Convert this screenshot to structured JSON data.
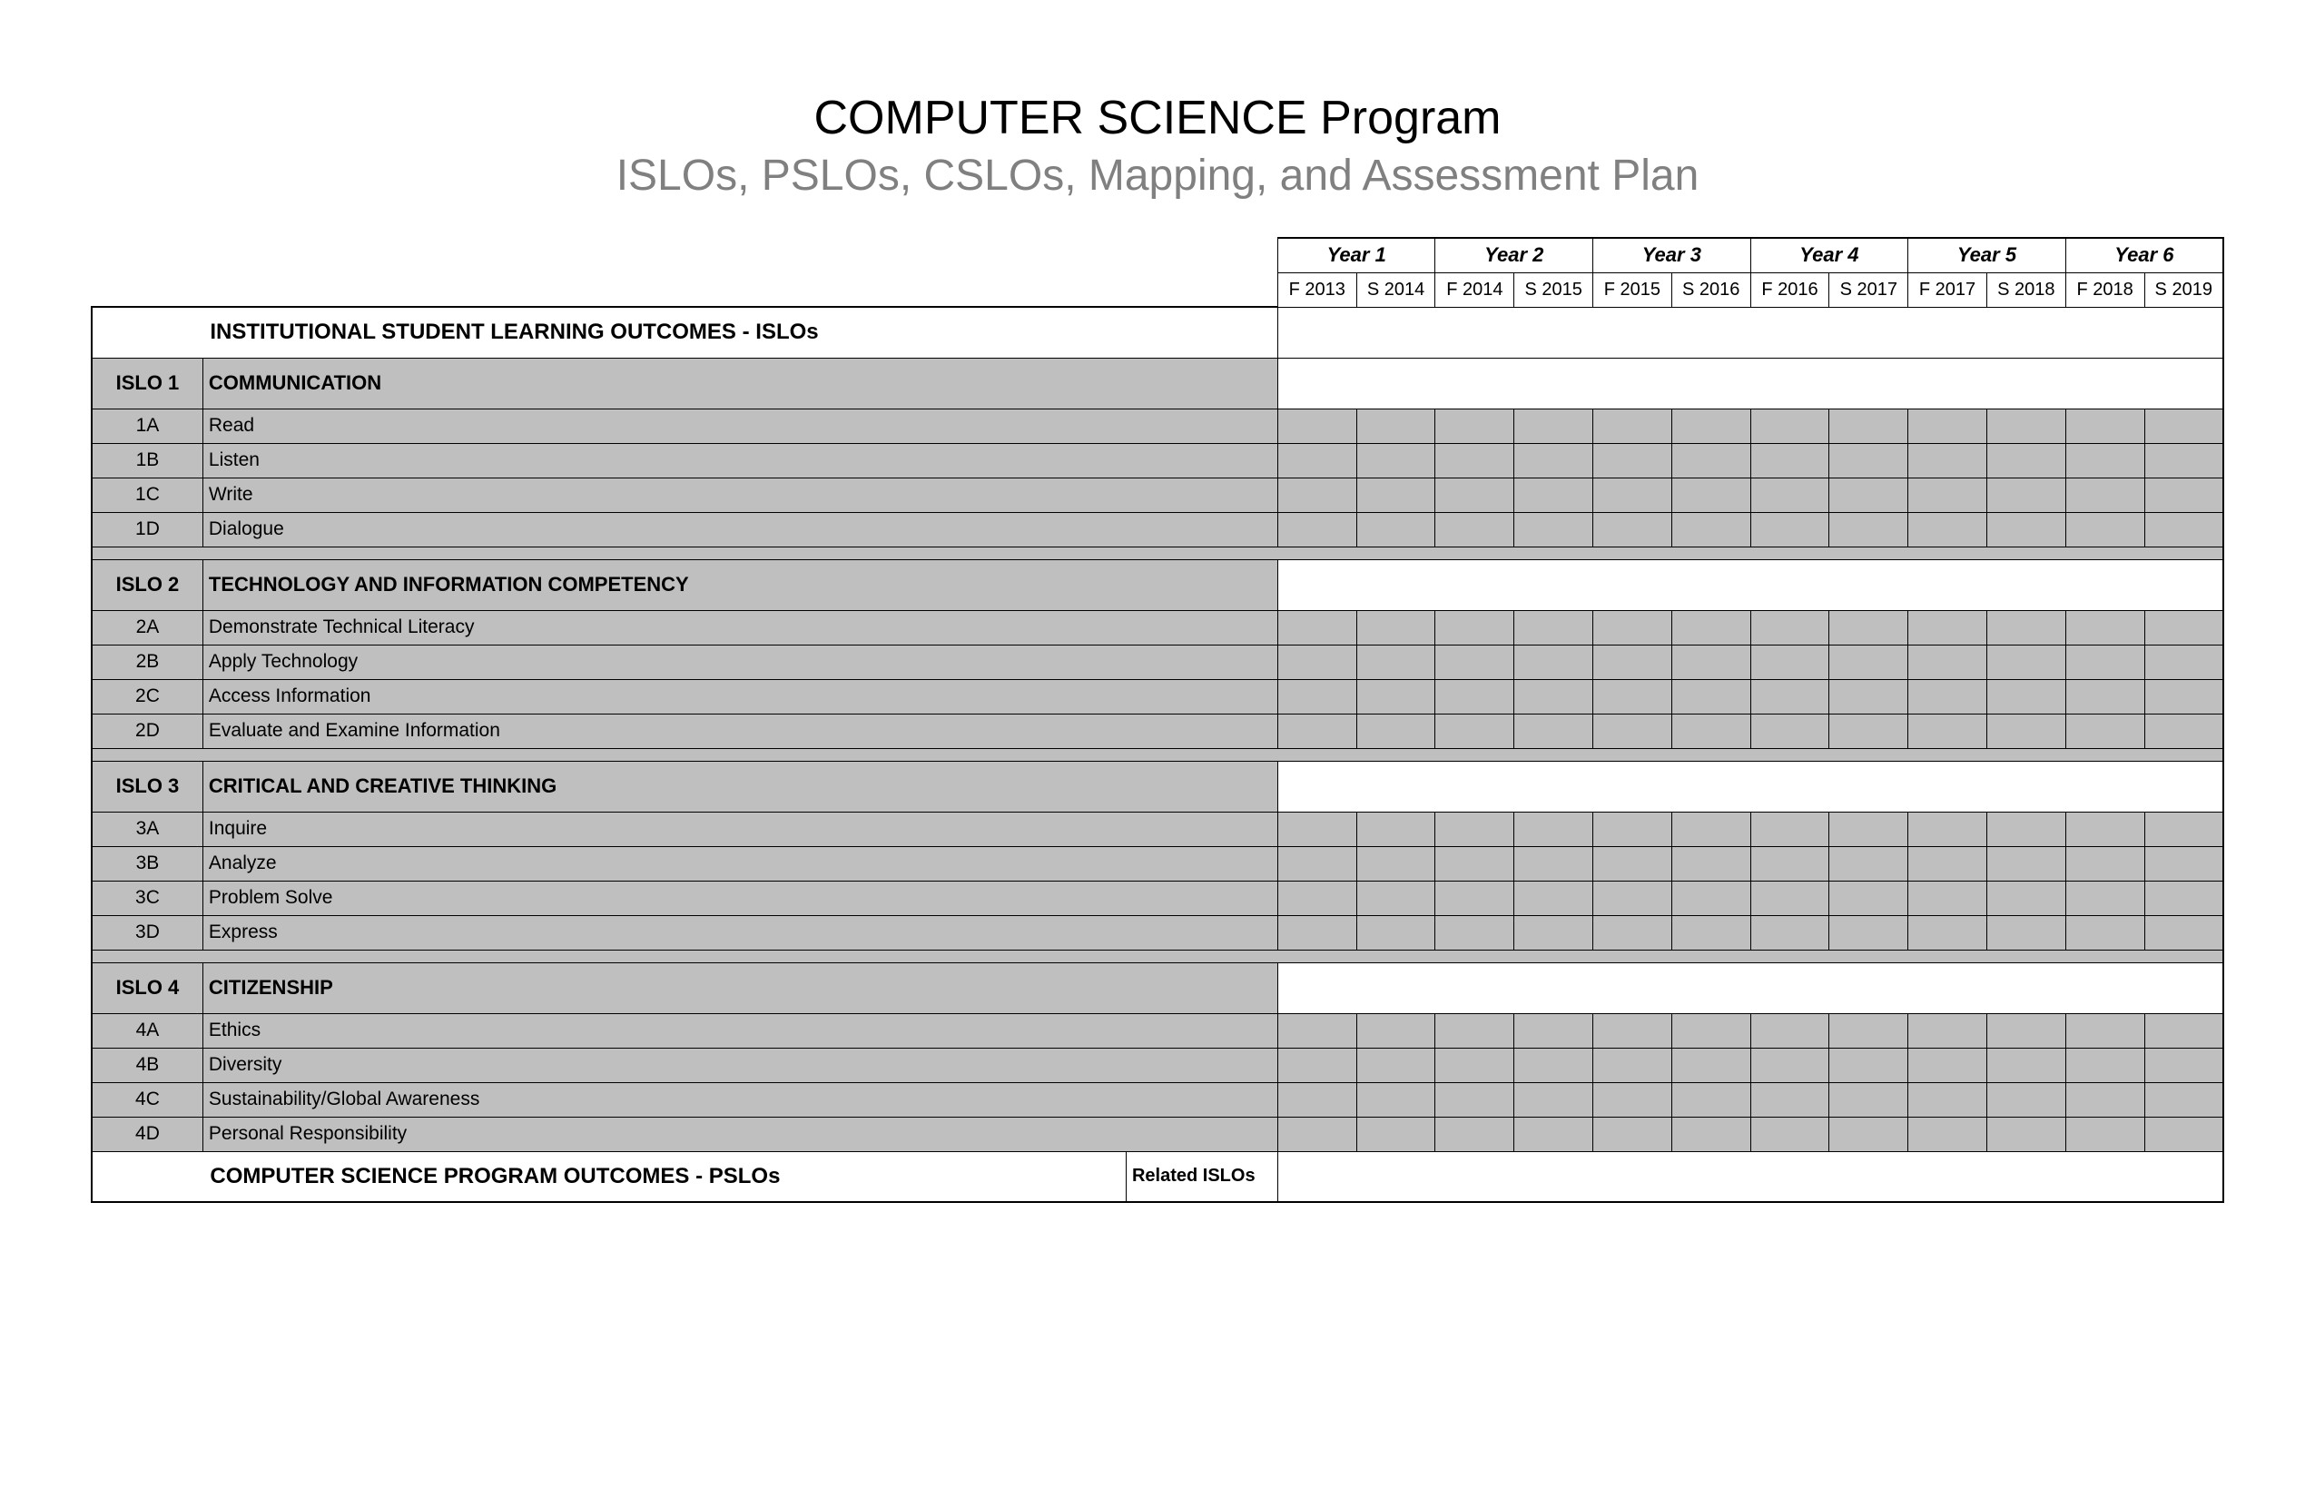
{
  "title": "COMPUTER SCIENCE Program",
  "subtitle": "ISLOs, PSLOs, CSLOs, Mapping, and Assessment Plan",
  "years": [
    "Year 1",
    "Year 2",
    "Year 3",
    "Year 4",
    "Year 5",
    "Year 6"
  ],
  "terms": [
    "F 2013",
    "S 2014",
    "F 2014",
    "S 2015",
    "F 2015",
    "S 2016",
    "F 2016",
    "S 2017",
    "F 2017",
    "S 2018",
    "F 2018",
    "S 2019"
  ],
  "section_islo_heading": "INSTITUTIONAL STUDENT LEARNING OUTCOMES - ISLOs",
  "islos": [
    {
      "code": "ISLO 1",
      "title": "COMMUNICATION",
      "items": [
        {
          "code": "1A",
          "label": "Read"
        },
        {
          "code": "1B",
          "label": "Listen"
        },
        {
          "code": "1C",
          "label": "Write"
        },
        {
          "code": "1D",
          "label": "Dialogue"
        }
      ]
    },
    {
      "code": "ISLO 2",
      "title": "TECHNOLOGY AND INFORMATION COMPETENCY",
      "items": [
        {
          "code": "2A",
          "label": "Demonstrate Technical Literacy"
        },
        {
          "code": "2B",
          "label": "Apply Technology"
        },
        {
          "code": "2C",
          "label": "Access Information"
        },
        {
          "code": "2D",
          "label": "Evaluate and Examine Information"
        }
      ]
    },
    {
      "code": "ISLO 3",
      "title": "CRITICAL AND CREATIVE THINKING",
      "items": [
        {
          "code": "3A",
          "label": "Inquire"
        },
        {
          "code": "3B",
          "label": "Analyze"
        },
        {
          "code": "3C",
          "label": "Problem Solve"
        },
        {
          "code": "3D",
          "label": "Express"
        }
      ]
    },
    {
      "code": "ISLO 4",
      "title": "CITIZENSHIP",
      "items": [
        {
          "code": "4A",
          "label": "Ethics"
        },
        {
          "code": "4B",
          "label": "Diversity"
        },
        {
          "code": "4C",
          "label": "Sustainability/Global Awareness"
        },
        {
          "code": "4D",
          "label": "Personal Responsibility"
        }
      ]
    }
  ],
  "section_pslo_heading": "COMPUTER SCIENCE PROGRAM OUTCOMES - PSLOs",
  "related_islos_label": "Related ISLOs"
}
